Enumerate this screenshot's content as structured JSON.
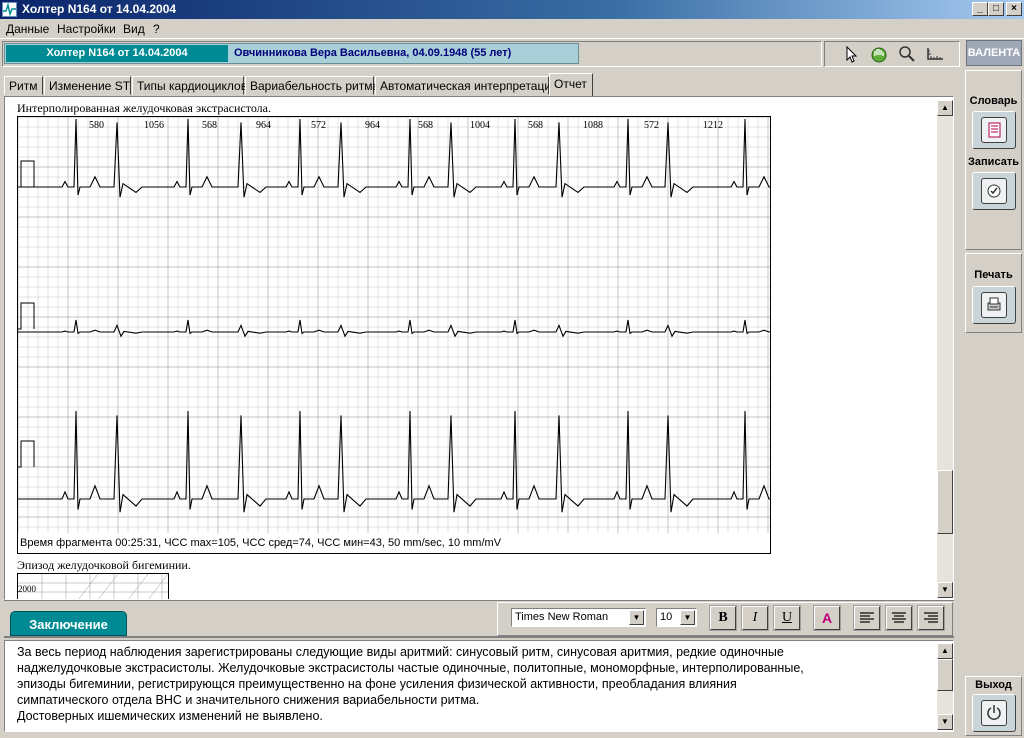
{
  "window": {
    "title": "Холтер  N164 от 14.04.2004",
    "controls": {
      "minimize": "_",
      "maximize": "□",
      "close": "×"
    }
  },
  "menu": [
    "Данные",
    "Настройки",
    "Вид",
    "?"
  ],
  "header": {
    "study": "Холтер  N164 от 14.04.2004",
    "patient": "Овчинникова Вера Васильевна,  04.09.1948  (55 лет)",
    "brand": "ВАЛЕНТА"
  },
  "tools": [
    "cursor-icon",
    "hand-icon",
    "magnifier-icon",
    "ruler-icon"
  ],
  "tabs": [
    "Ритм",
    "Изменение ST",
    "Типы кардиоциклов",
    "Вариабельность ритма",
    "Автоматическая интерпретация",
    "Отчет"
  ],
  "active_tab": "Отчет",
  "report": {
    "fragment1_title": "Интерполированная желудочковая экстрасистола.",
    "rr_intervals": [
      "580",
      "1056",
      "568",
      "964",
      "572",
      "964",
      "568",
      "1004",
      "568",
      "1088",
      "572",
      "1212"
    ],
    "fragment1_caption": "Время фрагмента 00:25:31,  ЧСС max=105,  ЧСС сред=74,  ЧСС мин=43, 50 mm/sec, 10 mm/mV",
    "fragment2_title": "Эпизод желудочковой бигеминии.",
    "fragment2_scale": "2000"
  },
  "conclusion": {
    "tab_label": "Заключение",
    "font": "Times New Roman",
    "font_size": "10",
    "bold": "B",
    "italic": "I",
    "underline": "U",
    "color_letter": "A",
    "color": "#c0007a",
    "lines": [
      "За весь период наблюдения зарегистрированы следующие виды аритмий: синусовый ритм, синусовая аритмия, редкие одиночные",
      "наджелудочковые экстрасистолы. Желудочковые экстрасистолы частые одиночные, политопные, мономорфные, интерполированные,",
      "эпизоды бигеминии, регистрирующся преимущественно на фоне усиления физической активности, преобладания влияния",
      "симпатического отдела ВНС и значительного снижения вариабельности ритма.",
      "Достоверных ишемических изменений не выявлено."
    ]
  },
  "sidebar": {
    "dictionary": "Словарь",
    "save": "Записать",
    "print": "Печать",
    "exit": "Выход"
  }
}
